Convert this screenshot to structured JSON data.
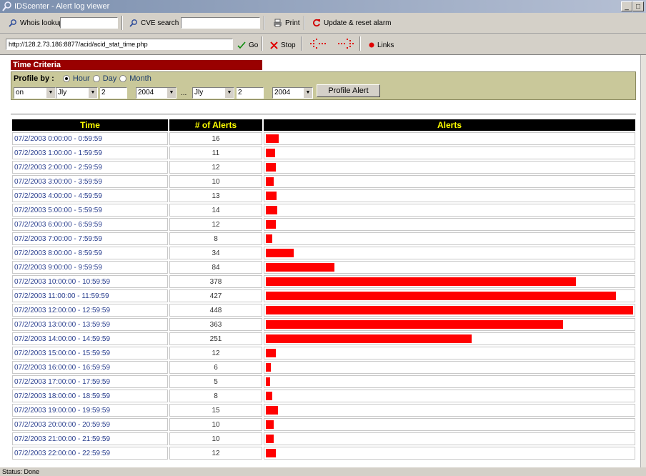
{
  "window": {
    "title": "IDScenter - Alert log viewer"
  },
  "toolbar": {
    "whois_label": "Whois lookup",
    "cve_label": "CVE search",
    "print_label": "Print",
    "update_label": "Update & reset alarm",
    "url": "http://128.2.73.186:8877/acid/acid_stat_time.php",
    "go_label": "Go",
    "stop_label": "Stop",
    "links_label": "Links"
  },
  "criteria": {
    "title": "Time Criteria",
    "profile_label": "Profile by :",
    "options": [
      "Hour",
      "Day",
      "Month"
    ],
    "selected": "Hour",
    "start": {
      "op": "on",
      "month": "Jly",
      "day": "2",
      "year": "2004"
    },
    "separator": "...",
    "end": {
      "month": "Jly",
      "day": "2",
      "year": "2004"
    },
    "button_label": "Profile Alert"
  },
  "table": {
    "headers": {
      "time": "Time",
      "count": "# of Alerts",
      "alerts": "Alerts"
    },
    "max": 448,
    "rows": [
      {
        "time": "07/2/2003 0:00:00 - 0:59:59",
        "count": 16
      },
      {
        "time": "07/2/2003 1:00:00 - 1:59:59",
        "count": 11
      },
      {
        "time": "07/2/2003 2:00:00 - 2:59:59",
        "count": 12
      },
      {
        "time": "07/2/2003 3:00:00 - 3:59:59",
        "count": 10
      },
      {
        "time": "07/2/2003 4:00:00 - 4:59:59",
        "count": 13
      },
      {
        "time": "07/2/2003 5:00:00 - 5:59:59",
        "count": 14
      },
      {
        "time": "07/2/2003 6:00:00 - 6:59:59",
        "count": 12
      },
      {
        "time": "07/2/2003 7:00:00 - 7:59:59",
        "count": 8
      },
      {
        "time": "07/2/2003 8:00:00 - 8:59:59",
        "count": 34
      },
      {
        "time": "07/2/2003 9:00:00 - 9:59:59",
        "count": 84
      },
      {
        "time": "07/2/2003 10:00:00 - 10:59:59",
        "count": 378
      },
      {
        "time": "07/2/2003 11:00:00 - 11:59:59",
        "count": 427
      },
      {
        "time": "07/2/2003 12:00:00 - 12:59:59",
        "count": 448
      },
      {
        "time": "07/2/2003 13:00:00 - 13:59:59",
        "count": 363
      },
      {
        "time": "07/2/2003 14:00:00 - 14:59:59",
        "count": 251
      },
      {
        "time": "07/2/2003 15:00:00 - 15:59:59",
        "count": 12
      },
      {
        "time": "07/2/2003 16:00:00 - 16:59:59",
        "count": 6
      },
      {
        "time": "07/2/2003 17:00:00 - 17:59:59",
        "count": 5
      },
      {
        "time": "07/2/2003 18:00:00 - 18:59:59",
        "count": 8
      },
      {
        "time": "07/2/2003 19:00:00 - 19:59:59",
        "count": 15
      },
      {
        "time": "07/2/2003 20:00:00 - 20:59:59",
        "count": 10
      },
      {
        "time": "07/2/2003 21:00:00 - 21:59:59",
        "count": 10
      },
      {
        "time": "07/2/2003 22:00:00 - 22:59:59",
        "count": 12
      }
    ]
  },
  "status": {
    "text": "Status: Done"
  },
  "colors": {
    "bar": "#ff0000",
    "header_bg": "#000000",
    "header_text": "#ffff00",
    "criteria_title_bg": "#990000",
    "criteria_box_bg": "#c9c89a"
  }
}
